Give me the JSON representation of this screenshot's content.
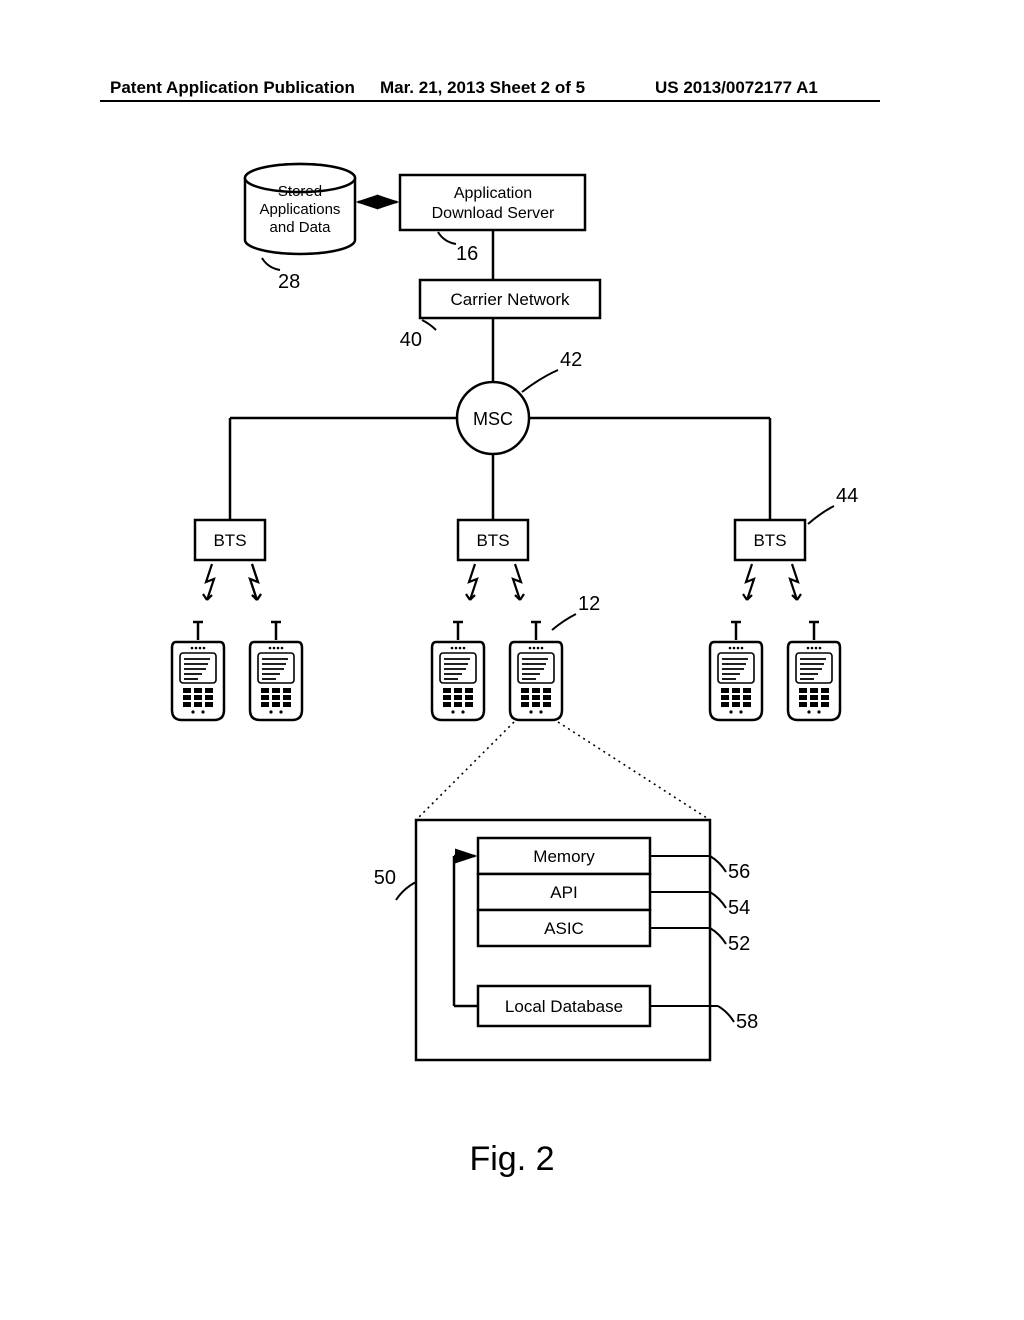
{
  "header": {
    "left": "Patent Application Publication",
    "mid": "Mar. 21, 2013  Sheet 2 of 5",
    "right": "US 2013/0072177 A1"
  },
  "nodes": {
    "db": {
      "line1": "Stored",
      "line2": "Applications",
      "line3": "and Data"
    },
    "server": {
      "line1": "Application",
      "line2": "Download Server"
    },
    "carrier": "Carrier Network",
    "msc": "MSC",
    "bts": "BTS",
    "memory": "Memory",
    "api": "API",
    "asic": "ASIC",
    "localdb": "Local Database"
  },
  "labels": {
    "n28": "28",
    "n16": "16",
    "n40": "40",
    "n42": "42",
    "n44": "44",
    "n12": "12",
    "n50": "50",
    "n56": "56",
    "n54": "54",
    "n52": "52",
    "n58": "58"
  },
  "figure": "Fig. 2"
}
